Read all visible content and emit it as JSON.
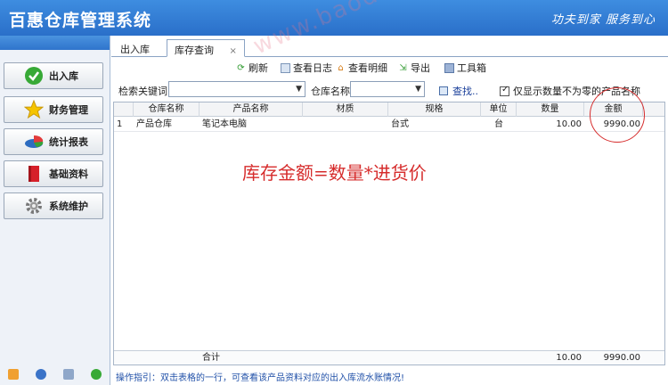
{
  "app": {
    "title": "百惠仓库管理系统",
    "slogan": "功夫到家 服务到心"
  },
  "sidebar": {
    "items": [
      {
        "label": "出入库",
        "icon": "check-circle-icon"
      },
      {
        "label": "财务管理",
        "icon": "star-icon"
      },
      {
        "label": "统计报表",
        "icon": "pie-chart-icon"
      },
      {
        "label": "基础资料",
        "icon": "book-icon"
      },
      {
        "label": "系统维护",
        "icon": "gear-icon"
      }
    ]
  },
  "tabs": [
    {
      "label": "出入库"
    },
    {
      "label": "库存查询",
      "close": "×"
    }
  ],
  "toolbar": {
    "refresh": "刷新",
    "view_log": "查看日志",
    "view_detail": "查看明细",
    "export": "导出",
    "toolbox": "工具箱"
  },
  "filter": {
    "keyword_label": "检索关键词",
    "keyword_value": "",
    "warehouse_label": "仓库名称",
    "warehouse_value": "",
    "find": "查找..",
    "nonzero_label": "仅显示数量不为零的产品名称"
  },
  "grid": {
    "columns": [
      "仓库名称",
      "产品名称",
      "材质",
      "规格",
      "单位",
      "数量",
      "金额"
    ],
    "rows": [
      {
        "no": "1",
        "warehouse": "产品仓库",
        "product": "笔记本电脑",
        "material": "",
        "spec": "台式",
        "unit": "台",
        "qty": "10.00",
        "amount": "9990.00"
      }
    ],
    "footer": {
      "label": "合计",
      "qty": "10.00",
      "amount": "9990.00"
    }
  },
  "annotation": "库存金额=数量*进货价",
  "watermark": "www.baodeyun.com",
  "status": "操作指引：双击表格的一行，可查看该产品资料对应的出入库流水账情况!"
}
